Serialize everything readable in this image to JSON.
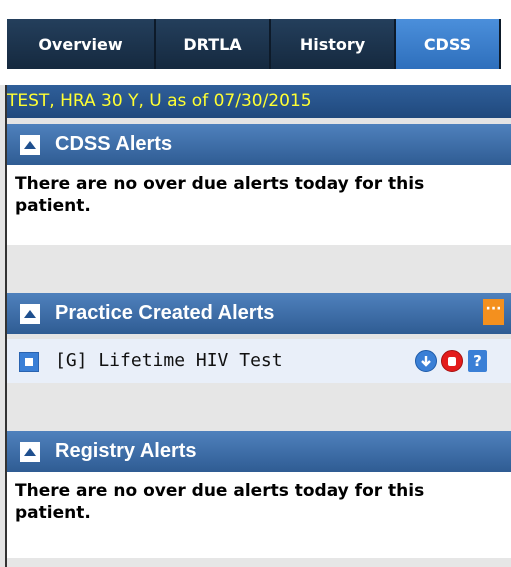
{
  "tabs": [
    {
      "label": "Overview",
      "active": false
    },
    {
      "label": "DRTLA",
      "active": false
    },
    {
      "label": "History",
      "active": false
    },
    {
      "label": "CDSS",
      "active": true
    }
  ],
  "patient_line": "TEST, HRA 30 Y, U as of 07/30/2015",
  "sections": {
    "cdss": {
      "title": "CDSS Alerts",
      "message": "There are no over due alerts today for this patient."
    },
    "practice": {
      "title": "Practice Created Alerts",
      "more_icon": "ellipsis-icon",
      "alerts": [
        {
          "text": "[G] Lifetime HIV Test",
          "icons": [
            "download-icon",
            "stop-hand-icon",
            "help-icon"
          ]
        }
      ]
    },
    "registry": {
      "title": "Registry Alerts",
      "message": "There are no over due alerts today for this patient."
    }
  },
  "colors": {
    "tab_bg": "#1b324d",
    "tab_active": "#3f83d1",
    "header_blue": "#3f6fa8",
    "patient_text": "#ffff33",
    "orange": "#f4901e"
  }
}
